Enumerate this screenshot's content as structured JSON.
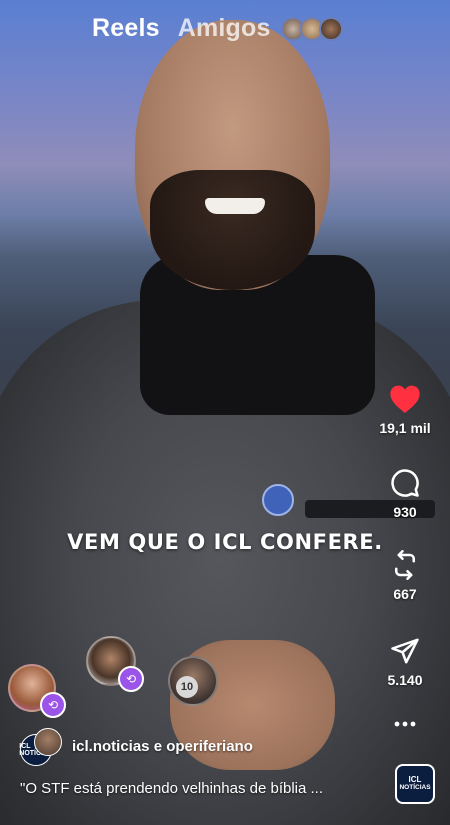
{
  "header": {
    "tabs": [
      {
        "label": "Reels",
        "active": true
      },
      {
        "label": "Amigos",
        "active": false
      }
    ]
  },
  "video": {
    "overlay_caption": "VEM QUE O ICL CONFERE."
  },
  "actions": {
    "like": {
      "icon": "heart-icon",
      "count": "19,1 mil",
      "color": "#ff3040",
      "liked": true
    },
    "comment": {
      "icon": "comment-icon",
      "count": "930"
    },
    "repost": {
      "icon": "repost-icon",
      "count": "667"
    },
    "share": {
      "icon": "send-icon",
      "count": "5.140"
    },
    "more": {
      "icon": "more-icon"
    }
  },
  "remixes": {
    "more_count": "10"
  },
  "post": {
    "author": "icl.noticias e operiferiano",
    "author_avatar_text": "ICL NOTÍCIAS",
    "caption": "\"O STF está prendendo velhinhas de bíblia ...",
    "audio_thumb_line1": "ICL",
    "audio_thumb_line2": "NOTÍCIAS"
  },
  "colors": {
    "remix_badge": "#9b54e8",
    "like_active": "#ff3040"
  }
}
